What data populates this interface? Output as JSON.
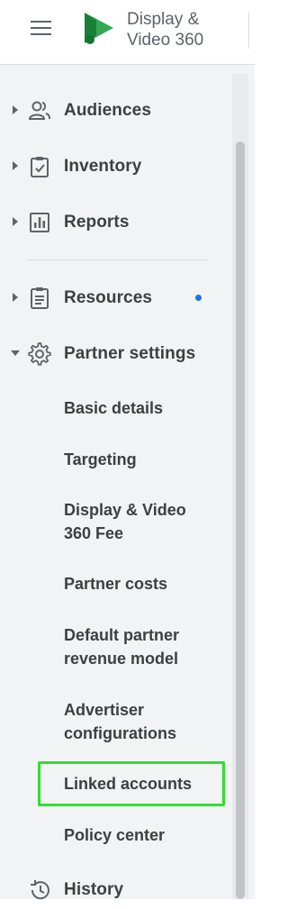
{
  "header": {
    "product_name_line1": "Display &",
    "product_name_line2": "Video 360",
    "brand_color": "#34a853"
  },
  "sidebar": {
    "items": [
      {
        "label": "Audiences",
        "icon": "people-icon",
        "expanded": false
      },
      {
        "label": "Inventory",
        "icon": "clipboard-check-icon",
        "expanded": false
      },
      {
        "label": "Reports",
        "icon": "bar-chart-icon",
        "expanded": false
      },
      {
        "label": "Resources",
        "icon": "document-icon",
        "expanded": false,
        "has_notification": true
      },
      {
        "label": "Partner settings",
        "icon": "gear-icon",
        "expanded": true
      },
      {
        "label": "History",
        "icon": "history-icon",
        "expanded": false
      }
    ],
    "partner_settings_children": [
      {
        "line1": "Basic details"
      },
      {
        "line1": "Targeting"
      },
      {
        "line1": "Display & Video",
        "line2": "360 Fee"
      },
      {
        "line1": "Partner costs"
      },
      {
        "line1": "Default partner",
        "line2": "revenue model"
      },
      {
        "line1": "Advertiser",
        "line2": "configurations"
      },
      {
        "line1": "Linked accounts",
        "highlighted": true
      },
      {
        "line1": "Policy center"
      }
    ],
    "notification_color": "#1a73e8",
    "highlight_color": "#2fe02f"
  }
}
